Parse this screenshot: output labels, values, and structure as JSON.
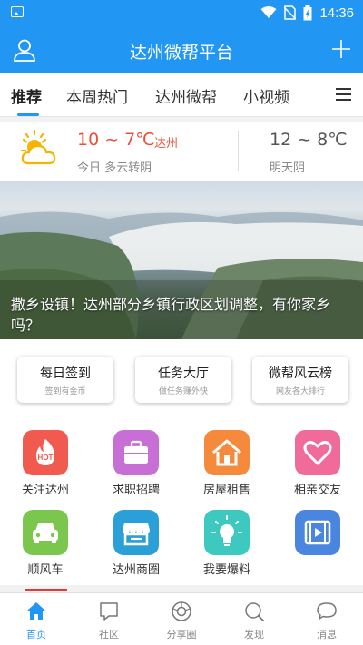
{
  "status_bar": {
    "time": "14:36"
  },
  "header": {
    "title": "达州微帮平台"
  },
  "tabs": [
    {
      "label": "推荐"
    },
    {
      "label": "本周热门"
    },
    {
      "label": "达州微帮"
    },
    {
      "label": "小视频"
    }
  ],
  "weather": {
    "today_temp": "10 ~ 7℃",
    "city": "达州",
    "today_desc": "今日 多云转阴",
    "tomorrow_temp": "12 ~ 8℃",
    "tomorrow_desc": "明天阴"
  },
  "banner": {
    "caption": "撒乡设镇！达州部分乡镇行政区划调整，有你家乡吗？"
  },
  "quick_actions": [
    {
      "title": "每日签到",
      "subtitle": "签到有金币"
    },
    {
      "title": "任务大厅",
      "subtitle": "做任务赚外快"
    },
    {
      "title": "微帮风云榜",
      "subtitle": "网友各大排行"
    }
  ],
  "grid": [
    {
      "label": "关注达州",
      "icon": "hot-icon",
      "color": "#f05a4f"
    },
    {
      "label": "求职招聘",
      "icon": "briefcase-icon",
      "color": "#c86fd6"
    },
    {
      "label": "房屋租售",
      "icon": "house-icon",
      "color": "#f68a3c"
    },
    {
      "label": "相亲交友",
      "icon": "heart-icon",
      "color": "#f06a9a"
    },
    {
      "label": "顺风车",
      "icon": "car-icon",
      "color": "#7bc74d"
    },
    {
      "label": "达州商圈",
      "icon": "store-icon",
      "color": "#2a9fd8"
    },
    {
      "label": "我要爆料",
      "icon": "bulb-icon",
      "color": "#3ec9c0"
    },
    {
      "label": "",
      "icon": "video-icon",
      "color": "#4a86e0"
    }
  ],
  "bottom_nav": [
    {
      "label": "首页",
      "icon": "home-icon"
    },
    {
      "label": "社区",
      "icon": "chat-bubble-icon"
    },
    {
      "label": "分享圈",
      "icon": "share-circle-icon"
    },
    {
      "label": "发现",
      "icon": "search-icon"
    },
    {
      "label": "消息",
      "icon": "message-icon"
    }
  ],
  "colors": {
    "primary": "#2196f3",
    "accent_red": "#e8503a"
  }
}
